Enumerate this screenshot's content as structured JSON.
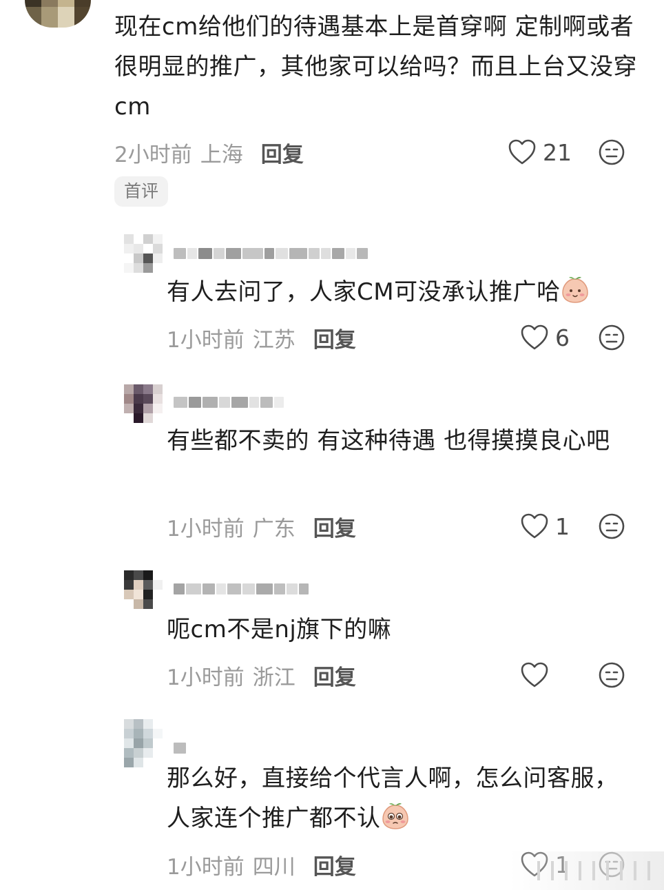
{
  "comments": [
    {
      "text": "现在cm给他们的待遇基本上是首穿啊 定制啊或者很明显的推广，其他家可以给吗？而且上台又没穿cm",
      "time": "2小时前",
      "location": "上海",
      "reply_label": "回复",
      "likes": "21",
      "tag": "首评"
    },
    {
      "text": "有人去问了，人家CM可没承认推广哈",
      "emoji": "peach-blush-emoji",
      "time": "1小时前",
      "location": "江苏",
      "reply_label": "回复",
      "likes": "6"
    },
    {
      "text": "有些都不卖的 有这种待遇 也得摸摸良心吧",
      "time": "1小时前",
      "location": "广东",
      "reply_label": "回复",
      "likes": "1"
    },
    {
      "text": "呃cm不是nj旗下的嘛",
      "time": "1小时前",
      "location": "浙江",
      "reply_label": "回复",
      "likes": ""
    },
    {
      "text": "那么好，直接给个代言人啊，怎么问客服，人家连个推广都不认",
      "emoji": "peach-pleading-emoji",
      "time": "1小时前",
      "location": "四川",
      "reply_label": "回复",
      "likes": "1"
    }
  ],
  "icons": {
    "like": "heart-outline-icon",
    "dislike": "meh-face-icon"
  },
  "colors": {
    "text": "#1e1e1e",
    "meta": "#9a9a9a",
    "reply": "#555555",
    "tag_bg": "#f2f2f2"
  }
}
